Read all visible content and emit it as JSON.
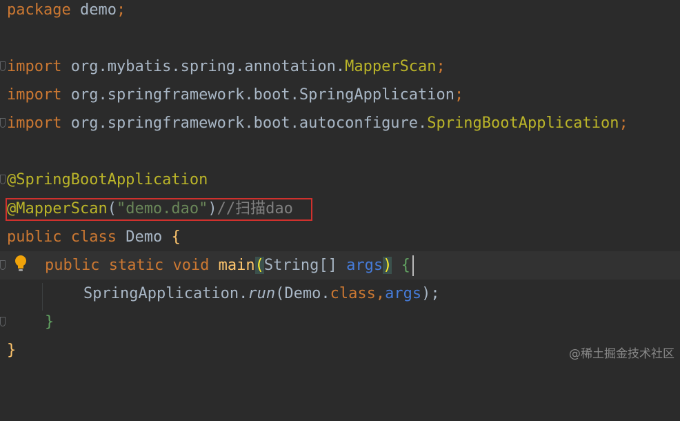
{
  "editor": {
    "line_package": {
      "kw": "package",
      "name": " demo",
      "semi": ";"
    },
    "line_import1": {
      "kw": "import",
      "path": " org.mybatis.spring.annotation.",
      "cls": "MapperScan",
      "semi": ";"
    },
    "line_import2": {
      "kw": "import",
      "path": " org.springframework.boot.SpringApplication",
      "semi": ";"
    },
    "line_import3": {
      "kw": "import",
      "path": " org.springframework.boot.autoconfigure.",
      "cls": "SpringBootApplication",
      "semi": ";"
    },
    "line_ann1": {
      "text": "@SpringBootApplication"
    },
    "line_ann2": {
      "ann": "@MapperScan",
      "open": "(",
      "str": "\"demo.dao\"",
      "close": ")",
      "comment": "//扫描dao"
    },
    "line_class": {
      "kw1": "public",
      "kw2": " class",
      "name": " Demo ",
      "brace": "{"
    },
    "line_main": {
      "kw1": "public",
      "kw2": " static",
      "kw3": " void",
      "fn": " main",
      "open": "(",
      "type": "String[] ",
      "param": "args",
      "close": ")",
      "brace": " {"
    },
    "line_run": {
      "cls": "SpringApplication.",
      "fn": "run",
      "open": "(",
      "arg1": "Demo.",
      "kw": "class",
      "comma": ",",
      "param": "args",
      "close": ");"
    },
    "line_close_inner": {
      "brace": "}"
    },
    "line_close_outer": {
      "brace": "}"
    }
  },
  "watermark": "@稀土掘金技术社区",
  "colors": {
    "background": "#2b2b2b",
    "keyword": "#cc7832",
    "annotation": "#bbb529",
    "string": "#6a8759",
    "comment": "#808080",
    "highlight_box": "#d0312d"
  },
  "icons": {
    "gutter_bulb": "lightbulb-icon",
    "fold": "fold-marker-icon"
  }
}
